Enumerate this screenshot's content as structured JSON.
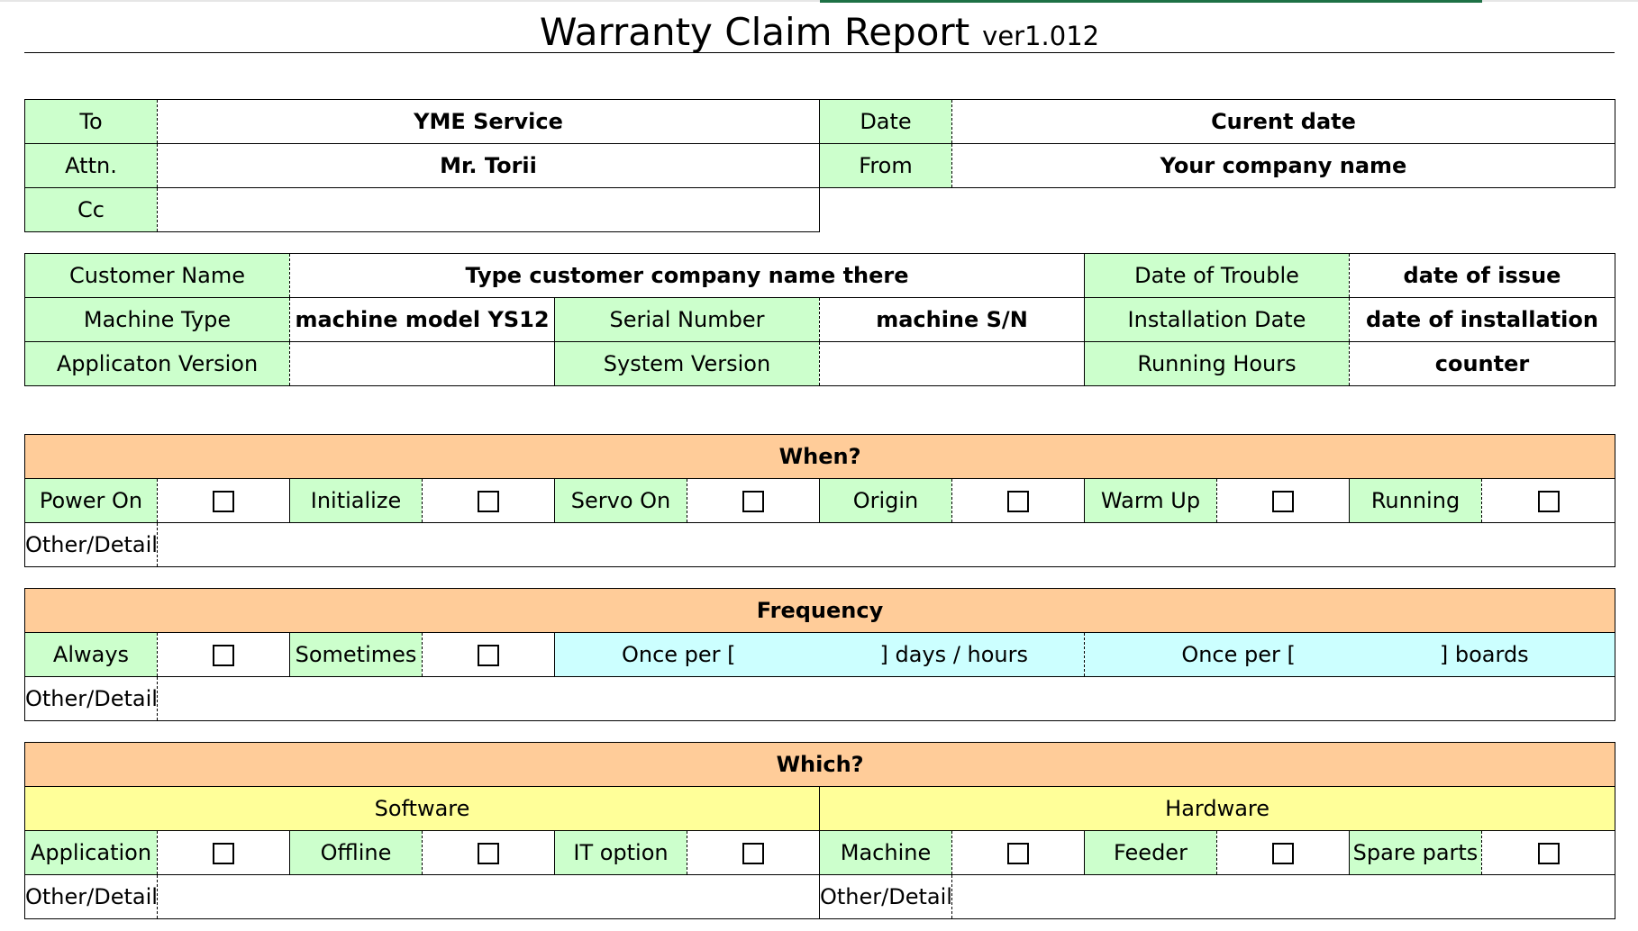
{
  "header": {
    "title": "Warranty Claim Report",
    "version": "ver1.012"
  },
  "contact": {
    "to_label": "To",
    "to_value": "YME Service",
    "date_label": "Date",
    "date_value": "Curent date",
    "attn_label": "Attn.",
    "attn_value": "Mr. Torii",
    "from_label": "From",
    "from_value": "Your company name",
    "cc_label": "Cc",
    "cc_value": ""
  },
  "customer": {
    "name_label": "Customer Name",
    "name_value": "Type customer company name there",
    "trouble_label": "Date of Trouble",
    "trouble_value": "date of issue",
    "machine_label": "Machine Type",
    "machine_value": "machine model YS12",
    "serial_label": "Serial Number",
    "serial_value": "machine S/N",
    "install_label": "Installation Date",
    "install_value": "date of installation",
    "app_label": "Applicaton Version",
    "app_value": "",
    "system_label": "System Version",
    "system_value": "",
    "hours_label": "Running Hours",
    "hours_value": "counter"
  },
  "when": {
    "heading": "When?",
    "options": [
      "Power On",
      "Initialize",
      "Servo On",
      "Origin",
      "Warm Up",
      "Running"
    ],
    "other_label": "Other/Detail"
  },
  "frequency": {
    "heading": "Frequency",
    "always_label": "Always",
    "sometimes_label": "Sometimes",
    "once_label": "Once per [",
    "days_unit": "] days / hours",
    "boards_unit": "] boards",
    "other_label": "Other/Detail"
  },
  "which": {
    "heading": "Which?",
    "software_label": "Software",
    "hardware_label": "Hardware",
    "software_options": [
      "Application",
      "Offline",
      "IT option"
    ],
    "hardware_options": [
      "Machine",
      "Feeder",
      "Spare parts"
    ],
    "other_label": "Other/Detail"
  },
  "colors": {
    "label_green": "#ccffcc",
    "section_orange": "#ffcc99",
    "category_yellow": "#ffff99",
    "input_cyan": "#ccffff"
  }
}
